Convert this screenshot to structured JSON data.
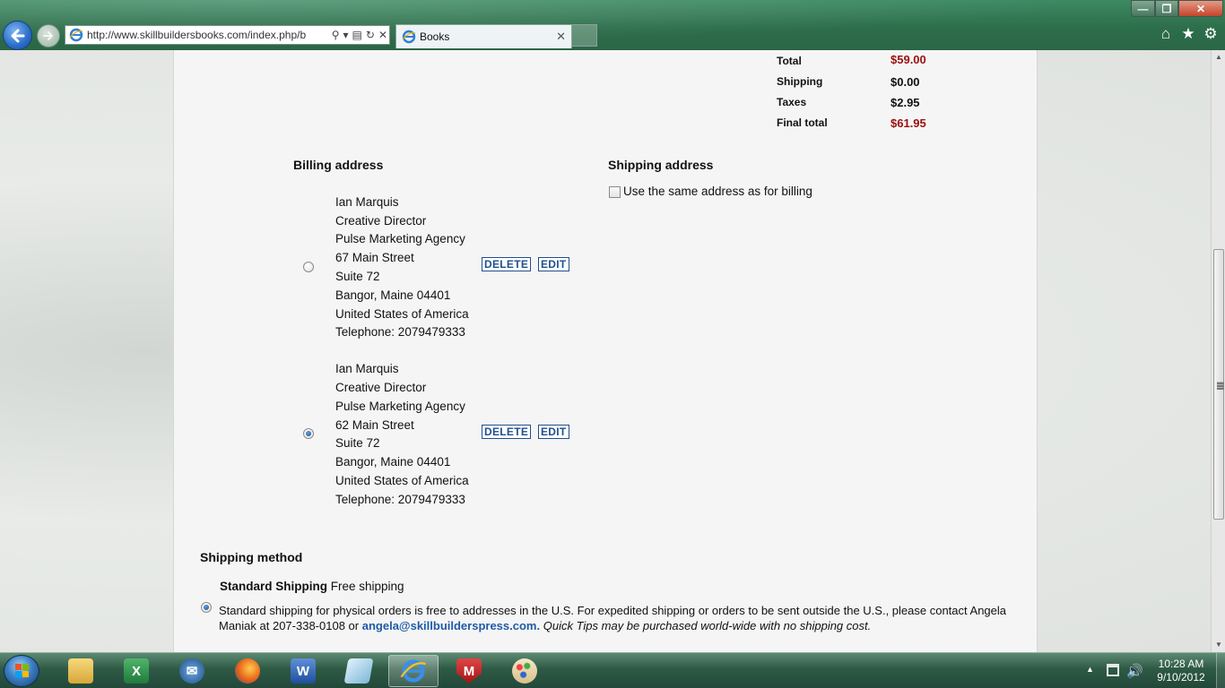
{
  "browser": {
    "url": "http://www.skillbuildersbooks.com/index.php/b",
    "tab_title": "Books",
    "tab_close": "✕",
    "window_controls": {
      "minimize": "—",
      "maximize": "❐",
      "close": "✕"
    },
    "address_tools": {
      "search": "⚲",
      "dropdown": "▾",
      "compat": "▤",
      "refresh": "↻",
      "stop": "✕"
    },
    "icons": {
      "home": "⌂",
      "favorites": "★",
      "tools": "⚙"
    }
  },
  "totals": [
    {
      "label": "Total",
      "value": "$59.00",
      "color": "#9b0f0f"
    },
    {
      "label": "Shipping",
      "value": "$0.00",
      "color": "#111111"
    },
    {
      "label": "Taxes",
      "value": "$2.95",
      "color": "#111111"
    },
    {
      "label": "Final total",
      "value": "$61.95",
      "color": "#9b0f0f"
    }
  ],
  "billing": {
    "heading": "Billing address",
    "addresses": [
      {
        "selected": false,
        "lines": [
          "Ian Marquis",
          "Creative Director",
          "Pulse Marketing Agency",
          "67 Main Street",
          "Suite 72",
          "Bangor, Maine 04401",
          "United States of America",
          "Telephone: 2079479333"
        ],
        "delete_label": "DELETE",
        "edit_label": "EDIT"
      },
      {
        "selected": true,
        "lines": [
          "Ian Marquis",
          "Creative Director",
          "Pulse Marketing Agency",
          "62 Main Street",
          "Suite 72",
          "Bangor, Maine 04401",
          "United States of America",
          "Telephone: 2079479333"
        ],
        "delete_label": "DELETE",
        "edit_label": "EDIT"
      }
    ]
  },
  "shipping_address": {
    "heading": "Shipping address",
    "same_as_billing_label": "Use the same address as for billing",
    "same_as_billing_checked": false
  },
  "shipping_method": {
    "heading": "Shipping method",
    "option_name": "Standard Shipping",
    "option_price": "Free shipping",
    "description": "Standard shipping for physical orders is free to addresses in the U.S. For expedited shipping or orders to be sent outside the U.S., please contact Angela Maniak at 207-338-0108 or",
    "email": "angela@skillbuilderspress.com.",
    "note": "Quick Tips may be purchased world-wide with no shipping cost.",
    "selected": true
  },
  "scrollbar": {
    "up": "▲",
    "down": "▼"
  },
  "taskbar": {
    "apps": [
      "windows-explorer",
      "excel",
      "thunderbird",
      "firefox",
      "word",
      "notepad",
      "internet-explorer",
      "mcafee",
      "paint"
    ],
    "active_app": "internet-explorer",
    "clock_time": "10:28 AM",
    "clock_date": "9/10/2012",
    "tray_arrow": "▲",
    "volume": "🔊"
  }
}
